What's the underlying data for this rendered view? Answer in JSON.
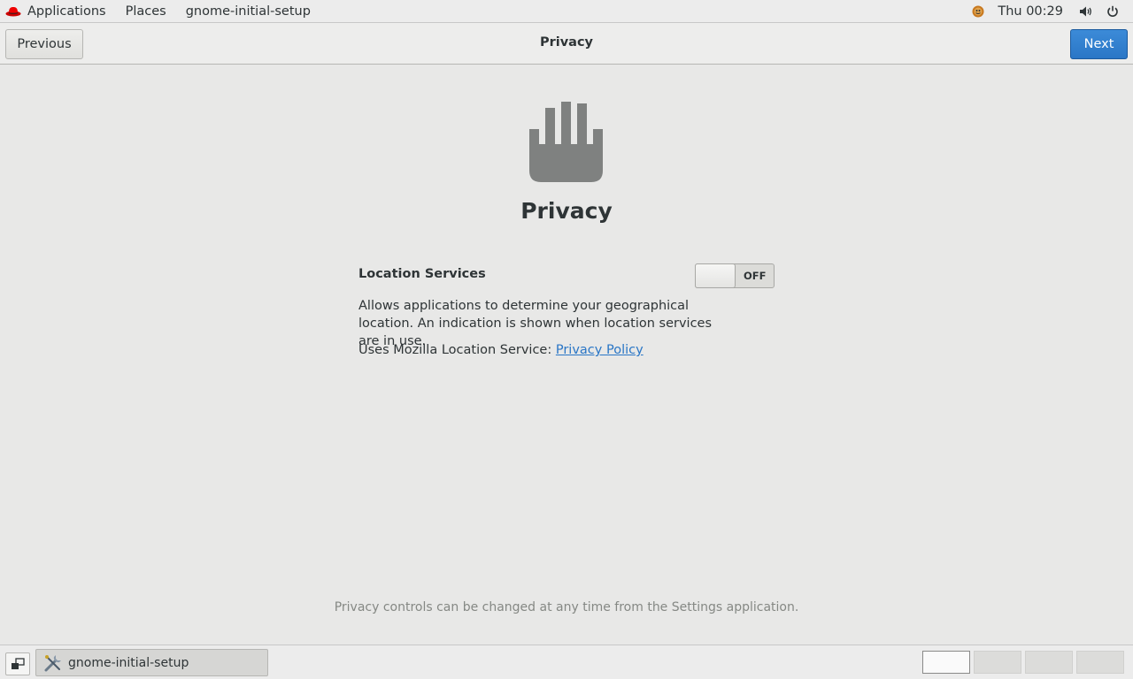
{
  "topbar": {
    "menus": [
      {
        "label": "Applications"
      },
      {
        "label": "Places"
      },
      {
        "label": "gnome-initial-setup"
      }
    ],
    "clock": "Thu 00:29",
    "tray_icons": [
      "user-avatar-icon",
      "volume-icon",
      "power-icon"
    ]
  },
  "header": {
    "previous_label": "Previous",
    "title": "Privacy",
    "next_label": "Next",
    "next_color": "#2a76c6"
  },
  "main": {
    "icon": "hand-icon",
    "title": "Privacy",
    "location_label": "Location Services",
    "location_state": "OFF",
    "description": "Allows applications to determine your geographical location. An indication is shown when location services are in use.",
    "service_prefix": "Uses Mozilla Location Service: ",
    "policy_link": "Privacy Policy",
    "footer_note": "Privacy controls can be changed at any time from the Settings application."
  },
  "taskbar": {
    "task_label": "gnome-initial-setup",
    "workspace_count": 4,
    "active_workspace": 1
  }
}
